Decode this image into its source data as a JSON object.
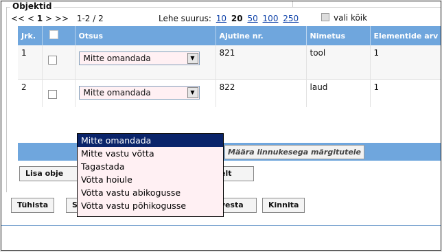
{
  "fieldset": {
    "legend": "Objektid"
  },
  "pager": {
    "first": "<<",
    "prev": "<",
    "pages": [
      "1"
    ],
    "next": ">",
    "last": ">>",
    "range": "1-2 / 2",
    "page_size_label": "Lehe suurus:",
    "sizes": [
      "10",
      "20",
      "50",
      "100",
      "250"
    ],
    "current_size": "20",
    "select_all_label": "vali kõik"
  },
  "table": {
    "columns": [
      "Jrk.",
      "",
      "Otsus",
      "Ajutine nr.",
      "Nimetus",
      "Elementide arv"
    ],
    "rows": [
      {
        "jrk": "1",
        "otsus": "Mitte omandada",
        "ajutine_nr": "821",
        "nimetus": "tool",
        "elementide_arv": "1"
      },
      {
        "jrk": "2",
        "otsus": "Mitte omandada",
        "ajutine_nr": "822",
        "nimetus": "laud",
        "elementide_arv": "1"
      }
    ]
  },
  "apply_button": "Määra linnukesega märgitutele",
  "buttons": {
    "lisa_objekt": "Lisa obje",
    "lt_suffix": "elt",
    "tuhista": "Tühista",
    "s_partial": "S",
    "salvesta_partial": "lvesta",
    "kinnita": "Kinnita"
  },
  "dropdown": {
    "options": [
      "Mitte omandada",
      "Mitte vastu võtta",
      "Tagastada",
      "Võtta hoiule",
      "Võtta vastu abikogusse",
      "Võtta vastu põhikogusse"
    ],
    "selected_index": 0
  },
  "colors": {
    "header_blue": "#6fa6dd",
    "select_bg": "#fff0f3",
    "selected_option": "#0a246a"
  }
}
